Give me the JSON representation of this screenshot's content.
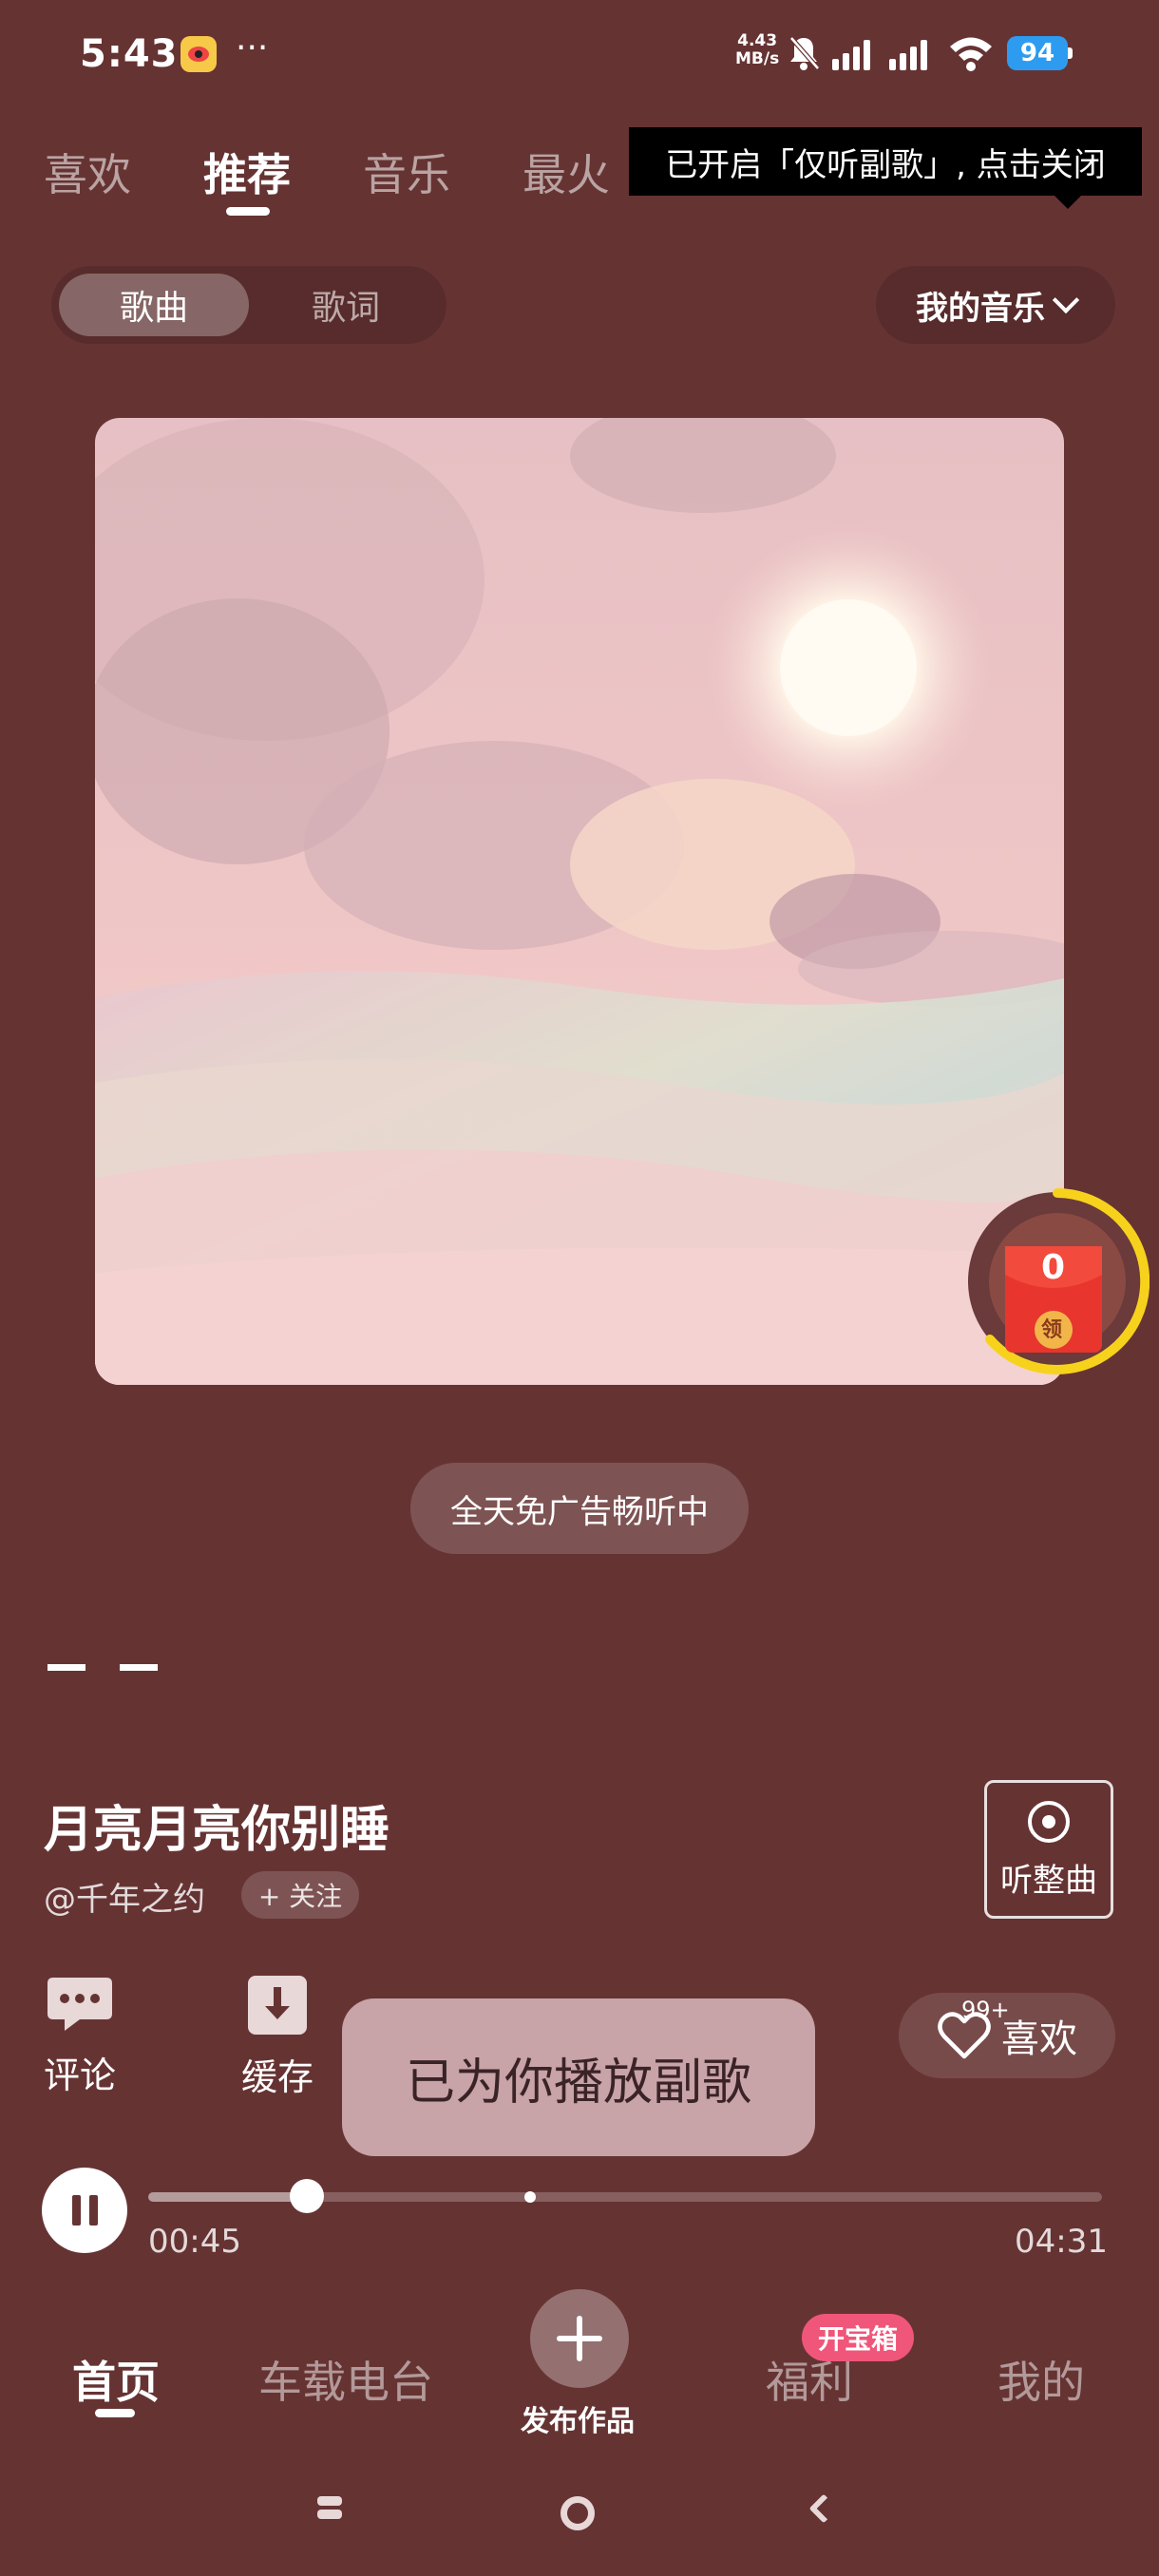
{
  "status_bar": {
    "time": "5:43",
    "more": "···",
    "net_speed_value": "4.43",
    "net_speed_unit": "MB/s",
    "battery": "94"
  },
  "top_tabs": [
    {
      "label": "喜欢",
      "active": false
    },
    {
      "label": "推荐",
      "active": true
    },
    {
      "label": "音乐",
      "active": false
    },
    {
      "label": "最火",
      "active": false
    }
  ],
  "tooltip_top": "已开启「仅听副歌」, 点击关闭",
  "segment": {
    "options": [
      "歌曲",
      "歌词"
    ],
    "selected": "歌曲"
  },
  "my_music_label": "我的音乐",
  "red_badge_count": "0",
  "red_badge_label": "领",
  "ad_free_label": "全天免广告畅听中",
  "song": {
    "title": "月亮月亮你别睡",
    "artist": "@千年之约",
    "follow_label": "+ 关注"
  },
  "full_song_label": "听整曲",
  "actions": {
    "comment_label": "评论",
    "cache_label": "缓存",
    "like_label": "喜欢",
    "like_count": "99+"
  },
  "toast": "已为你播放副歌",
  "player": {
    "current_time": "00:45",
    "total_time": "04:31",
    "progress": 0.166,
    "chorus_marker": 0.4
  },
  "bottom_nav": {
    "items": [
      "首页",
      "车载电台",
      "发布作品",
      "福利",
      "我的"
    ],
    "active": "首页",
    "treasure_badge": "开宝箱"
  },
  "colors": {
    "background": "#663333",
    "toast_bg": "#c8a3a8",
    "badge_pink": "#f0567a",
    "battery_blue": "#2d9cf0"
  }
}
